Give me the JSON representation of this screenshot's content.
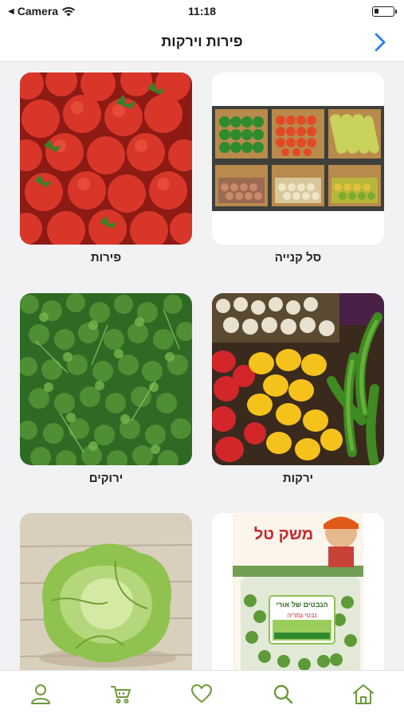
{
  "status": {
    "back_app": "Camera",
    "time": "11:18"
  },
  "nav": {
    "title": "פירות וירקות",
    "back_icon": "chevron-right-icon"
  },
  "categories": [
    {
      "label": "סל קנייה",
      "image": "produce-crates"
    },
    {
      "label": "פירות",
      "image": "strawberries"
    },
    {
      "label": "ירקות",
      "image": "peppers-and-radishes"
    },
    {
      "label": "ירוקים",
      "image": "parsley"
    },
    {
      "label": "",
      "image": "sprouts-package",
      "package_text": "משק טל",
      "package_label": "הנבטים של אורי",
      "package_sub": "נבטי גמריה"
    },
    {
      "label": "",
      "image": "iceberg-lettuce"
    }
  ],
  "tab_bar": {
    "items": [
      "home-icon",
      "search-icon",
      "heart-icon",
      "cart-icon",
      "user-icon"
    ],
    "accent": "#6c9a3a"
  },
  "colors": {
    "accent_blue": "#2f7df6",
    "tab_green": "#6c9a3a"
  }
}
